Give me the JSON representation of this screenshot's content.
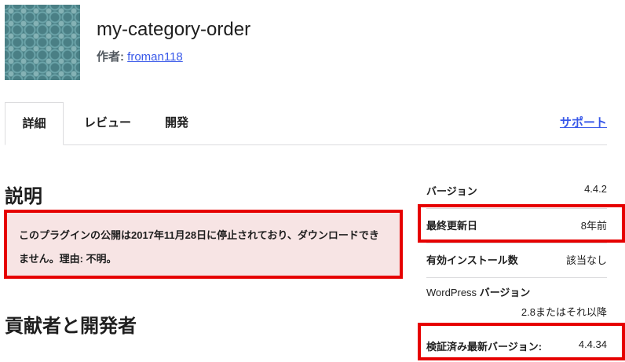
{
  "plugin": {
    "title": "my-category-order",
    "author_label": "作者:",
    "author_name": "froman118"
  },
  "tabs": {
    "details": "詳細",
    "reviews": "レビュー",
    "development": "開発",
    "support": "サポート"
  },
  "main": {
    "description_heading": "説明",
    "notice_line1": "このプラグインの公開は2017年11月28日に停止されており、ダウンロードでき",
    "notice_line2": "ません。理由: 不明。",
    "contributors_heading": "貢献者と開発者"
  },
  "meta": {
    "version_label": "バージョン",
    "version_value": "4.4.2",
    "updated_label": "最終更新日",
    "updated_value": "8年前",
    "installs_label": "有効インストール数",
    "installs_value": "該当なし",
    "wp_version_label_prefix": "WordPress",
    "wp_version_label_suffix": "バージョン",
    "wp_version_value": "2.8またはそれ以降",
    "tested_label": "検証済み最新バージョン:",
    "tested_value": "4.4.34"
  },
  "colors": {
    "highlight": "#e60000",
    "link": "#3858e9",
    "notice_bg": "#f7e4e4"
  },
  "icons": {
    "plugin_icon": "plugin-banner-icon"
  }
}
